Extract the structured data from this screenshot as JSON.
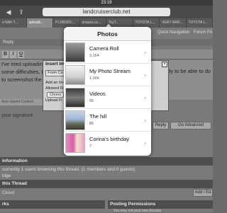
{
  "status": {
    "time": "23:19"
  },
  "browser": {
    "url": "landcruiserclub.net",
    "back_icon": "◀",
    "share_icon": "⇪",
    "tabs": [
      "d With T...",
      "uploadi...",
      "P1280303...",
      "snopes.co...",
      "ToyT...",
      "TOYOTA L...",
      "VERY RAR...",
      "TOYOTA L..."
    ]
  },
  "forum": {
    "quick_navigation": "Quick Navigation",
    "forum_fav": "Forum FA",
    "reply_label": "Reply",
    "toolbar_buttons": [
      "B",
      "I",
      "U"
    ],
    "editor_lines": [
      "I've tried uploading",
      "some difficulties, I ar",
      "to screenshot the st"
    ],
    "editor_right": "andy to be able to do",
    "autosaved": "Auto-Saved Content",
    "signature_label": "your signature",
    "go_advanced": "Go Advanced",
    "reply_button": "Reply",
    "information_title": "Information",
    "browsing_text": "currently 1 users browsing this thread. (1 members and 0 guests)",
    "pledge_text": "ldge",
    "thread_title": "this Thread",
    "cloud_text": "Cloud",
    "add_edit": "Add / Ed",
    "bottom_left_title": "rks",
    "posting_permissions": "Posting Permissions",
    "perm_text": "You may not post new threads"
  },
  "dialog": {
    "title": "Insert Im",
    "close_icon": "×",
    "tab_label": "From Co",
    "lines": [
      "Add an Im",
      "Allowed Fi",
      "Upload Fi"
    ],
    "choose_label": "Choos"
  },
  "photos_popover": {
    "title": "Photos",
    "albums": [
      {
        "name": "Camera Roll",
        "count": "3,164"
      },
      {
        "name": "My Photo Stream",
        "count": "1,006"
      },
      {
        "name": "Videos",
        "count": "65"
      },
      {
        "name": "The hill",
        "count": "86"
      },
      {
        "name": "Corina's birthday",
        "count": "7"
      }
    ]
  },
  "icons": {
    "chevron": "›",
    "close": "×"
  },
  "colors": {
    "popover_bg": "#ffffff",
    "overlay": "#6b6b6b",
    "section_header": "#4e4e4e"
  }
}
